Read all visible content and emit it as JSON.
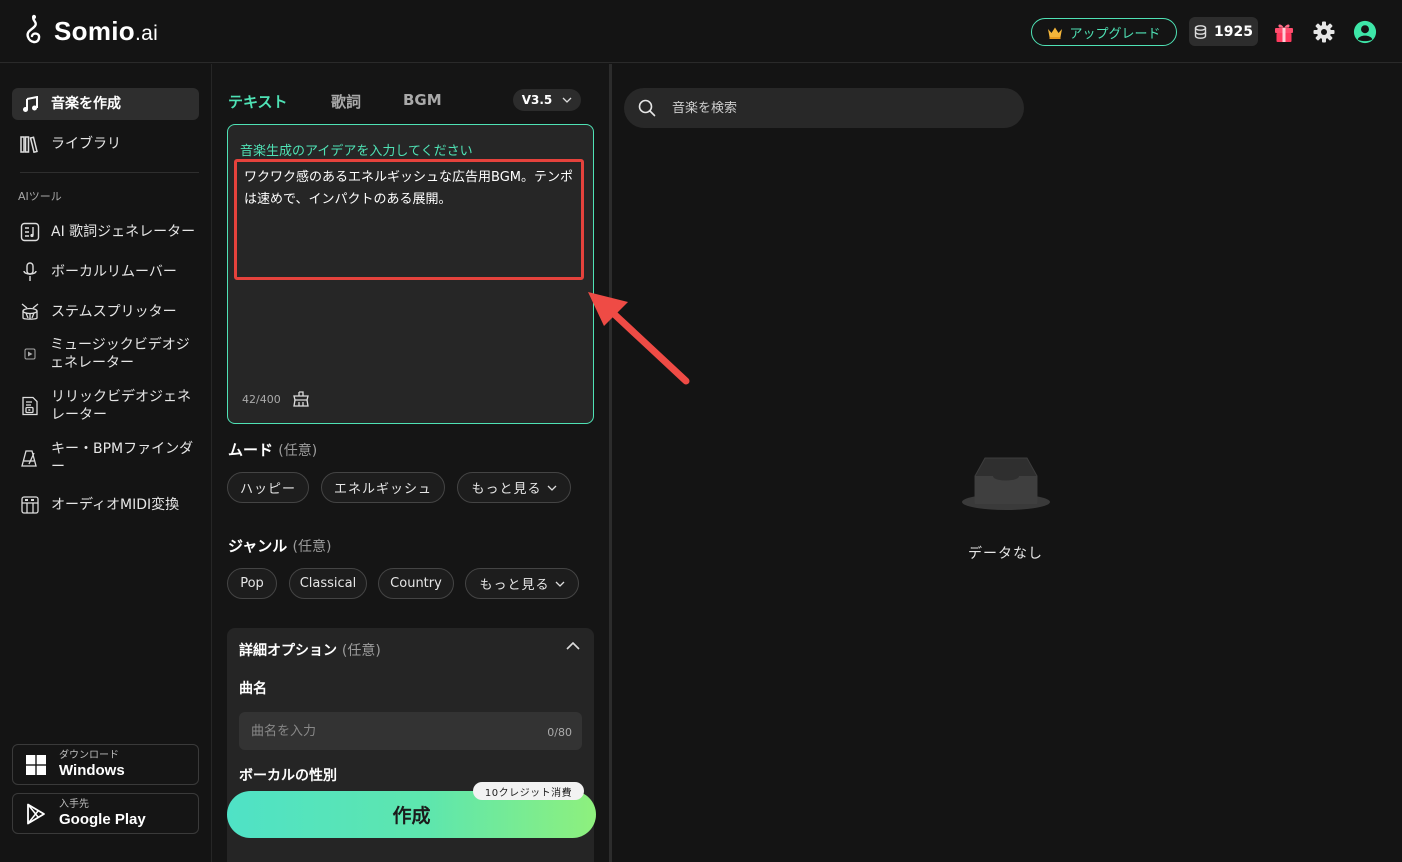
{
  "brand": {
    "name": "Somio",
    "suffix": ".ai"
  },
  "header": {
    "upgrade_label": "アップグレード",
    "credits": "1925"
  },
  "sidebar": {
    "primary": [
      {
        "label": "音楽を作成",
        "icon": "music-note-icon",
        "active": true
      },
      {
        "label": "ライブラリ",
        "icon": "library-icon",
        "active": false
      }
    ],
    "section_label": "AIツール",
    "tools": [
      {
        "label": "AI 歌詞ジェネレーター",
        "icon": "lyrics-doc-icon"
      },
      {
        "label": "ボーカルリムーバー",
        "icon": "microphone-icon"
      },
      {
        "label": "ステムスプリッター",
        "icon": "drum-icon"
      },
      {
        "label": "ミュージックビデオジェネレーター",
        "line1": "ミュージックビデオジ",
        "line2": "ェネレーター",
        "icon": "video-icon"
      },
      {
        "label": "リリックビデオジェネレーター",
        "line1": "リリックビデオジェネ",
        "line2": "レーター",
        "icon": "lyric-video-icon"
      },
      {
        "label": "キー・BPMファインダー",
        "line1": "キー・BPMファインダ",
        "line2": "ー",
        "icon": "metronome-icon"
      },
      {
        "label": "オーディオMIDI変換",
        "icon": "piano-icon"
      }
    ],
    "downloads": [
      {
        "small": "ダウンロード",
        "big": "Windows",
        "icon": "windows-icon"
      },
      {
        "small": "入手先",
        "big": "Google Play",
        "icon": "google-play-icon"
      }
    ]
  },
  "create": {
    "tabs": [
      "テキスト",
      "歌詞",
      "BGM"
    ],
    "active_tab": "テキスト",
    "version": "V3.5",
    "prompt": {
      "label": "音楽生成のアイデアを入力してください",
      "value": "ワクワク感のあるエネルギッシュな広告用BGM。テンポは速めで、インパクトのある展開。",
      "counter": "42/400"
    },
    "mood": {
      "title": "ムード",
      "optional": "(任意)",
      "chips": [
        "ハッピー",
        "エネルギッシュ"
      ],
      "more": "もっと見る"
    },
    "genre": {
      "title": "ジャンル",
      "optional": "(任意)",
      "chips": [
        "Pop",
        "Classical",
        "Country"
      ],
      "more": "もっと見る"
    },
    "advanced": {
      "title": "詳細オプション",
      "optional": "(任意)",
      "song_title_label": "曲名",
      "song_title_placeholder": "曲名を入力",
      "song_title_count": "0/80",
      "vocal_gender_label": "ボーカルの性別"
    },
    "create_button": "作成",
    "credit_cost": "10クレジット消費"
  },
  "results": {
    "search_placeholder": "音楽を検索",
    "empty_text": "データなし"
  },
  "colors": {
    "accent": "#4fe2b5",
    "highlight_box": "#e5423c",
    "background": "#151515"
  }
}
